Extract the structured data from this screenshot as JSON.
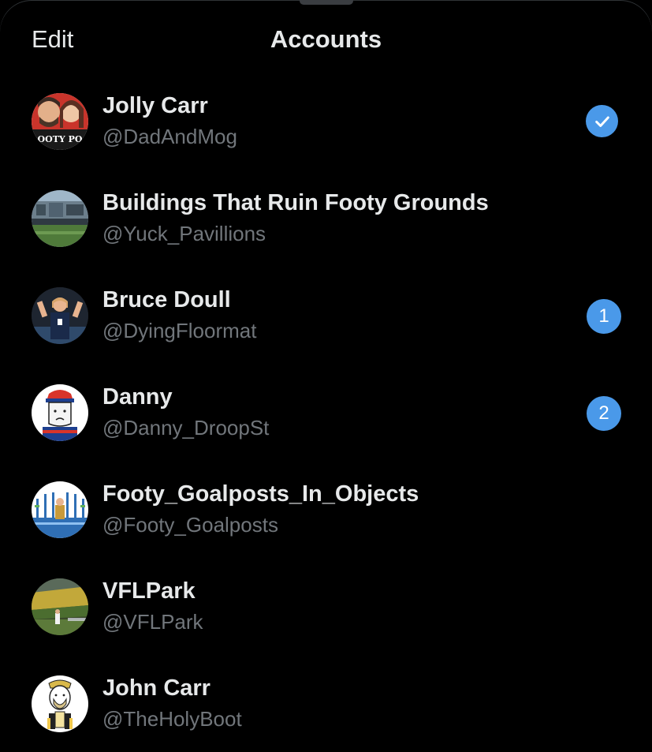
{
  "header": {
    "edit_label": "Edit",
    "title": "Accounts"
  },
  "accounts": [
    {
      "name": "Jolly Carr",
      "handle": "@DadAndMog",
      "active": true,
      "avatar_text": "OOTY PO"
    },
    {
      "name": "Buildings That Ruin Footy Grounds",
      "handle": "@Yuck_Pavillions"
    },
    {
      "name": "Bruce Doull",
      "handle": "@DyingFloormat",
      "unread": "1"
    },
    {
      "name": "Danny",
      "handle": "@Danny_DroopSt",
      "unread": "2"
    },
    {
      "name": "Footy_Goalposts_In_Objects",
      "handle": "@Footy_Goalposts"
    },
    {
      "name": "VFLPark",
      "handle": "@VFLPark"
    },
    {
      "name": "John Carr",
      "handle": "@TheHolyBoot"
    }
  ],
  "colors": {
    "accent": "#4a99e9",
    "background": "#000000",
    "primary_text": "#e7e9ea",
    "secondary_text": "#71767b"
  },
  "icons": {
    "active_account": "checkmark-icon"
  }
}
